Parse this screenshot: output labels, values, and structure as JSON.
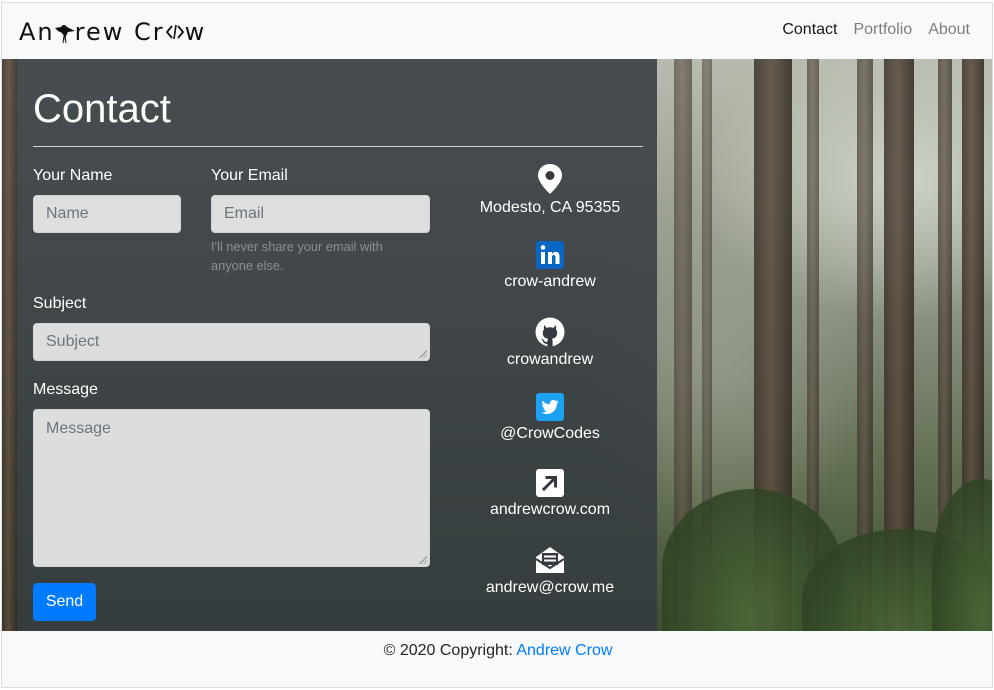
{
  "brand": {
    "name_part1": "An",
    "name_part2": "rew Cr",
    "name_part3": "w",
    "logo_icon": "crow-icon",
    "code_icon": "code-icon"
  },
  "nav": {
    "items": [
      {
        "label": "Contact",
        "active": true
      },
      {
        "label": "Portfolio",
        "active": false
      },
      {
        "label": "About",
        "active": false
      }
    ]
  },
  "contact": {
    "title": "Contact",
    "name_label": "Your Name",
    "name_placeholder": "Name",
    "email_label": "Your Email",
    "email_placeholder": "Email",
    "email_hint": "I'll never share your email with anyone else.",
    "subject_label": "Subject",
    "subject_placeholder": "Subject",
    "message_label": "Message",
    "message_placeholder": "Message",
    "send_label": "Send"
  },
  "info": [
    {
      "icon": "map-pin-icon",
      "text": "Modesto, CA 95355"
    },
    {
      "icon": "linkedin-icon",
      "text": "crow-andrew"
    },
    {
      "icon": "github-icon",
      "text": "crowandrew"
    },
    {
      "icon": "twitter-icon",
      "text": "@CrowCodes"
    },
    {
      "icon": "external-link-icon",
      "text": "andrewcrow.com"
    },
    {
      "icon": "envelope-icon",
      "text": "andrew@crow.me"
    }
  ],
  "footer": {
    "prefix": "© 2020 Copyright: ",
    "link": "Andrew Crow"
  },
  "colors": {
    "accent": "#007bff",
    "panel": "#343a40",
    "linkedin": "#0a66c2",
    "twitter": "#1da1f2"
  }
}
